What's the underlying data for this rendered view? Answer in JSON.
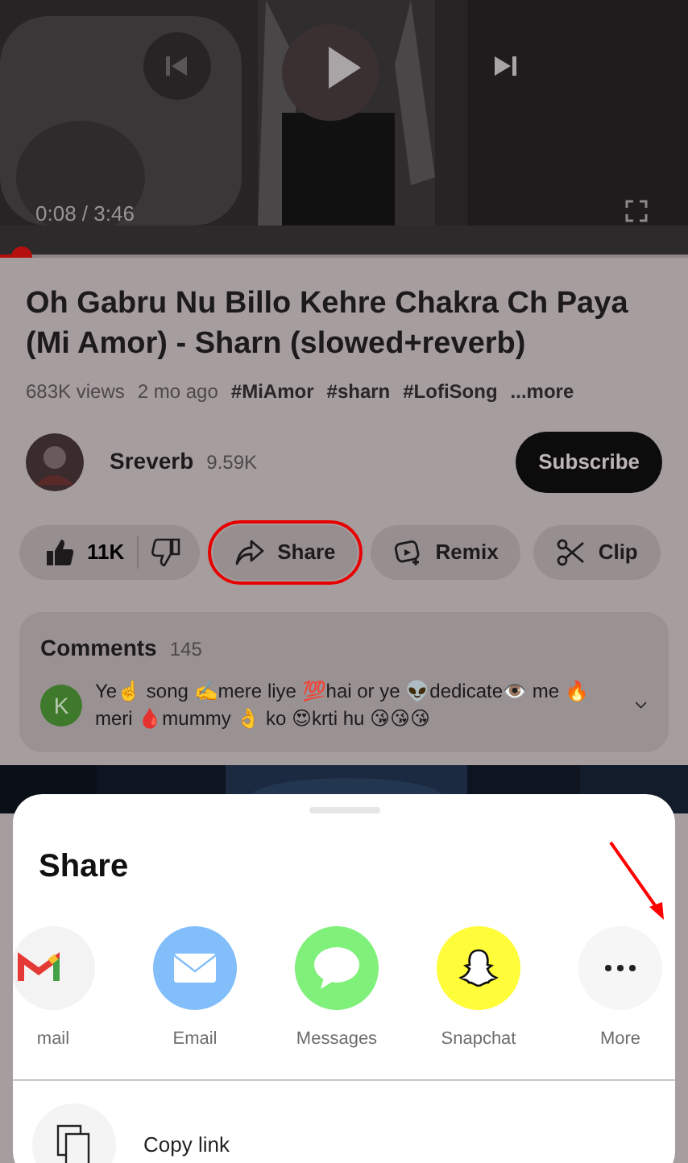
{
  "player": {
    "time": "0:08 / 3:46",
    "level": 0.03
  },
  "video": {
    "title": "Oh Gabru Nu Billo Kehre Chakra Ch Paya (Mi Amor) - Sharn (slowed+reverb)",
    "views": "683K views",
    "age": "2 mo ago",
    "tags": [
      "#MiAmor",
      "#sharn",
      "#LofiSong"
    ],
    "more": "...more"
  },
  "channel": {
    "name": "Sreverb",
    "subscribers": "9.59K",
    "subscribe": "Subscribe"
  },
  "actions": [
    {
      "kind": "like",
      "label": "11K",
      "highlighted": false
    },
    {
      "kind": "share",
      "label": "Share",
      "highlighted": true
    },
    {
      "kind": "remix",
      "label": "Remix",
      "highlighted": false
    },
    {
      "kind": "clip",
      "label": "Clip",
      "highlighted": false
    }
  ],
  "comments": {
    "title": "Comments",
    "count": "145",
    "avatar": "K",
    "text": "Ye☝️ song ✍️mere liye 💯hai or ye 👽dedicate👁️ me 🔥 meri 🩸mummy 👌 ko 😍krti hu 😘😘😘"
  },
  "share_sheet": {
    "title": "Share",
    "targets": [
      {
        "kind": "gmail",
        "label": "mail",
        "pointed": false
      },
      {
        "kind": "email",
        "label": "Email",
        "pointed": false
      },
      {
        "kind": "messages",
        "label": "Messages",
        "pointed": false
      },
      {
        "kind": "snapchat",
        "label": "Snapchat",
        "pointed": false
      },
      {
        "kind": "more",
        "label": "More",
        "pointed": true
      }
    ],
    "copy_link": "Copy link"
  }
}
